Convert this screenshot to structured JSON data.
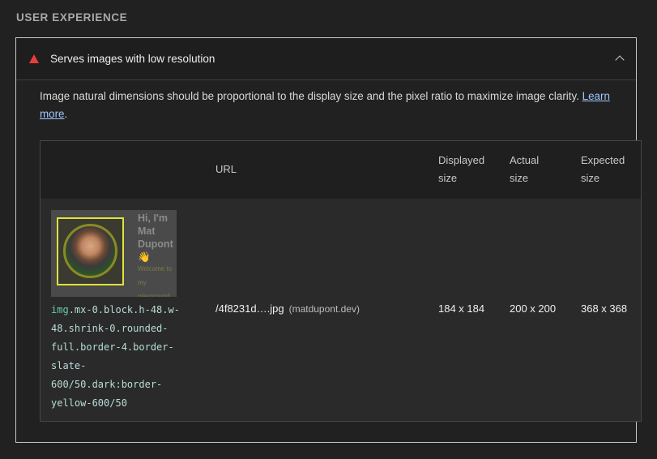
{
  "section": {
    "title": "USER EXPERIENCE"
  },
  "audit": {
    "title": "Serves images with low resolution",
    "description": "Image natural dimensions should be proportional to the display size and the pixel ratio to maximize image clarity.",
    "learn_more_part1": "Learn",
    "learn_more_part2": "more",
    "period": "."
  },
  "table": {
    "headers": {
      "url": "URL",
      "displayed_1": "Displayed",
      "displayed_2": "size",
      "actual_1": "Actual",
      "actual_2": "size",
      "expected_1": "Expected",
      "expected_2": "size"
    },
    "row": {
      "thumb_heading": "Hi, I'm Mat Dupont 👋",
      "thumb_small": "Welcome to my playground",
      "selector_tag": "img",
      "selector_rest": ".mx-0.block.h-48.w-\n48.shrink-0.rounded-\nfull.border-4.border-\nslate-\n600/50.dark:border-\nyellow-600/50",
      "url": "/4f8231d….jpg",
      "origin": "(matdupont.dev)",
      "displayed": "184 x 184",
      "actual": "200 x 200",
      "expected": "368 x 368"
    }
  },
  "colors": {
    "background": "#212121",
    "warning": "#eb3b3b",
    "link": "#9ec7ff",
    "highlight": "#e1e13c"
  },
  "icons": [
    "warning-triangle-icon",
    "chevron-up-icon"
  ]
}
